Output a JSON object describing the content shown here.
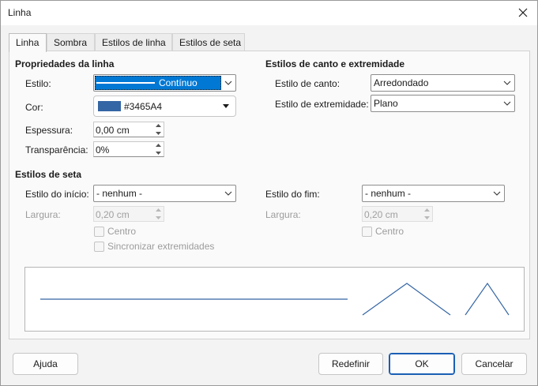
{
  "window": {
    "title": "Linha"
  },
  "tabs": [
    "Linha",
    "Sombra",
    "Estilos de linha",
    "Estilos de seta"
  ],
  "line_props": {
    "title": "Propriedades da linha",
    "style_label": "Estilo:",
    "style_value": "Contínuo",
    "color_label": "Cor:",
    "color_value": "#3465A4",
    "color_swatch": "#3465A4",
    "width_label": "Espessura:",
    "width_value": "0,00 cm",
    "transparency_label": "Transparência:",
    "transparency_value": "0%"
  },
  "corner_styles": {
    "title": "Estilos de canto e extremidade",
    "corner_label": "Estilo de canto:",
    "corner_value": "Arredondado",
    "cap_label": "Estilo de extremidade:",
    "cap_value": "Plano"
  },
  "arrow_styles": {
    "title": "Estilos de seta",
    "start_label": "Estilo do início:",
    "start_value": "- nenhum -",
    "end_label": "Estilo do fim:",
    "end_value": "- nenhum -",
    "width_label": "Largura:",
    "start_width": "0,20 cm",
    "end_width": "0,20 cm",
    "center_label": "Centro",
    "sync_label": "Sincronizar extremidades"
  },
  "buttons": {
    "help": "Ajuda",
    "reset": "Redefinir",
    "ok": "OK",
    "cancel": "Cancelar"
  },
  "colors": {
    "accent": "#1a5fb4",
    "selection": "#0078d4",
    "line": "#3465A4"
  }
}
